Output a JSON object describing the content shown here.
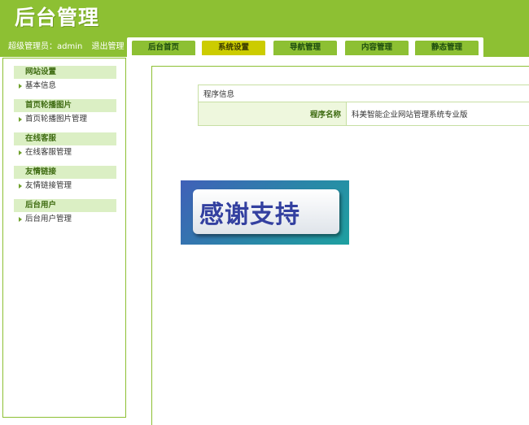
{
  "header": {
    "logo": "后台管理",
    "user_label": "超级管理员：admin",
    "logout_label": "退出管理"
  },
  "tabs": [
    {
      "label": "后台首页",
      "active": false
    },
    {
      "label": "系统设置",
      "active": true
    },
    {
      "label": "导航管理",
      "active": false
    },
    {
      "label": "内容管理",
      "active": false
    },
    {
      "label": "静态管理",
      "active": false
    }
  ],
  "sidebar": {
    "groups": [
      {
        "title": "网站设置",
        "links": [
          "基本信息"
        ]
      },
      {
        "title": "首页轮播图片",
        "links": [
          "首页轮播图片管理"
        ]
      },
      {
        "title": "在线客服",
        "links": [
          "在线客服管理"
        ]
      },
      {
        "title": "友情链接",
        "links": [
          "友情链接管理"
        ]
      },
      {
        "title": "后台用户",
        "links": [
          "后台用户管理"
        ]
      }
    ]
  },
  "info": {
    "heading": "程序信息",
    "name_label": "程序名称",
    "name_value": "科美智能企业网站管理系统专业版"
  },
  "banner": {
    "text": "感谢支持"
  },
  "colors": {
    "header_green": "#8dc033",
    "active_tab": "#cccc00",
    "label_text": "#3f6c12"
  }
}
